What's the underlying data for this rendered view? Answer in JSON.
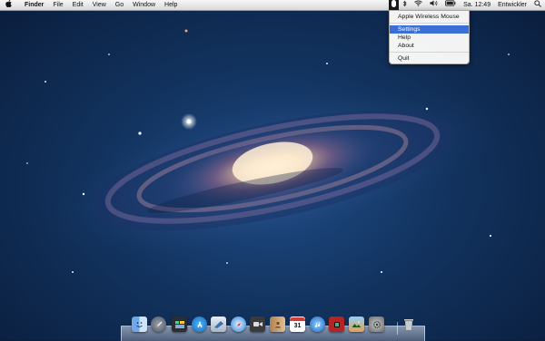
{
  "menubar": {
    "apple_icon": "apple-icon",
    "app_name": "Finder",
    "menus": [
      "File",
      "Edit",
      "View",
      "Go",
      "Window",
      "Help"
    ],
    "status": {
      "clock": "Sa. 12:49",
      "user": "Entwickler"
    }
  },
  "dropdown": {
    "items": [
      {
        "label": "Apple Wireless Mouse"
      },
      {
        "label": "Settings"
      },
      {
        "label": "Help"
      },
      {
        "label": "About"
      },
      {
        "label": "Quit"
      }
    ],
    "selected_item": "Settings"
  },
  "dock": {
    "calendar_day": "31",
    "apps": [
      "finder-icon",
      "launchpad-icon",
      "dashboard-icon",
      "app-store-icon",
      "mail-icon",
      "safari-icon",
      "facetime-icon",
      "contacts-icon",
      "calendar-icon",
      "itunes-icon",
      "photo-booth-icon",
      "iphoto-icon",
      "system-preferences-icon",
      "trash-icon"
    ]
  }
}
